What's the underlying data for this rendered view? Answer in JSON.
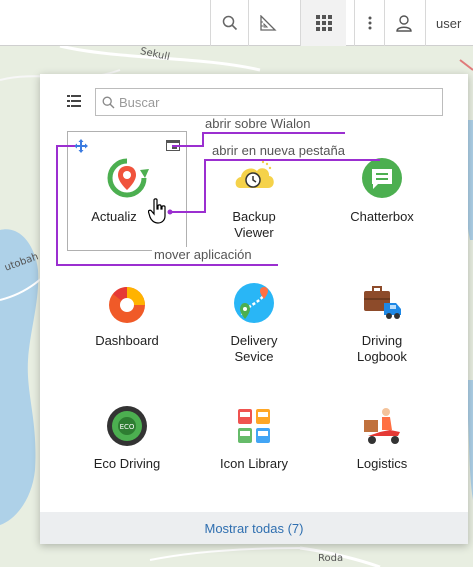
{
  "toolbar": {
    "user_label": "user",
    "icons": [
      "search-icon",
      "ruler-icon",
      "apps-grid-icon",
      "more-icon",
      "user-icon"
    ]
  },
  "map": {
    "labels": [
      "Sekull",
      "utobah",
      "Roda"
    ]
  },
  "panel": {
    "search_placeholder": "Buscar",
    "footer_label": "Mostrar todas (7)",
    "apps": [
      {
        "label": "Actualiz",
        "icon": "refresh-location-icon"
      },
      {
        "label": "Backup\nViewer",
        "icon": "backup-clock-icon"
      },
      {
        "label": "Chatterbox",
        "icon": "chat-icon"
      },
      {
        "label": "Dashboard",
        "icon": "pie-chart-icon"
      },
      {
        "label": "Delivery\nSevice",
        "icon": "route-pin-icon"
      },
      {
        "label": "Driving\nLogbook",
        "icon": "truck-briefcase-icon"
      },
      {
        "label": "Eco Driving",
        "icon": "eco-wheel-icon"
      },
      {
        "label": "Icon Library",
        "icon": "bus-icons-icon"
      },
      {
        "label": "Logistics",
        "icon": "delivery-scooter-icon"
      }
    ]
  },
  "annotations": {
    "open_in_wialon": "abrir sobre Wialon",
    "open_new_tab": "abrir en nueva pestaña",
    "move_app": "mover aplicación",
    "color": "#9b2fd0"
  },
  "colors": {
    "accent_link": "#2f6fb0",
    "annotation": "#9b2fd0"
  }
}
